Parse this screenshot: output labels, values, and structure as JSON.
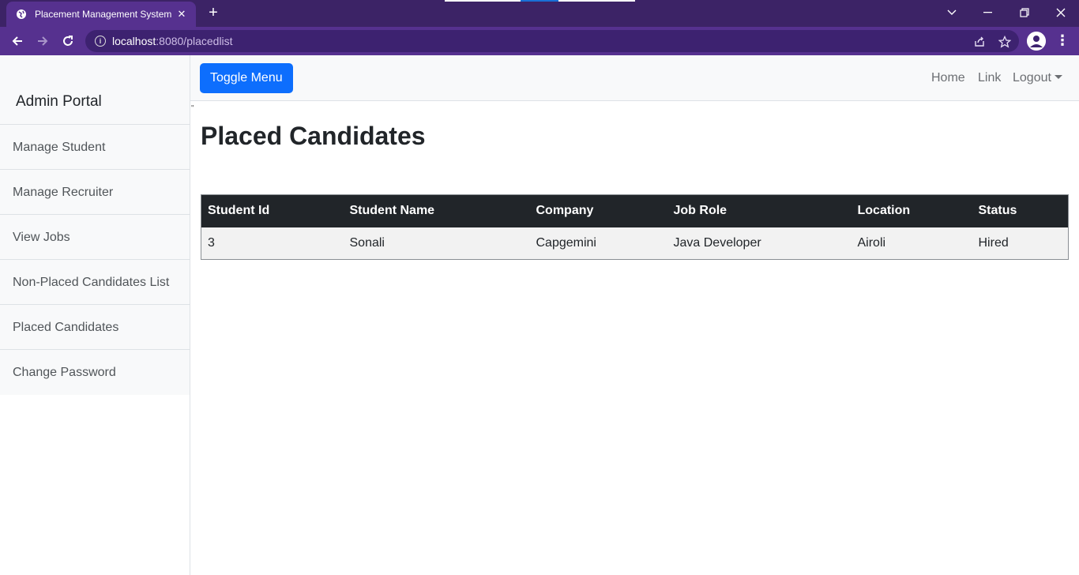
{
  "browser": {
    "tab_title": "Placement Management System",
    "close_glyph": "✕",
    "new_tab_glyph": "+",
    "url_host": "localhost",
    "url_rest": ":8080/placedlist",
    "theme_color": "#56318f"
  },
  "sidebar": {
    "heading": "Admin Portal",
    "items": [
      {
        "label": "Manage Student"
      },
      {
        "label": "Manage Recruiter"
      },
      {
        "label": "View Jobs"
      },
      {
        "label": "Non-Placed Candidates List"
      },
      {
        "label": "Placed Candidates"
      },
      {
        "label": "Change Password"
      }
    ]
  },
  "topnav": {
    "toggle_label": "Toggle Menu",
    "home_label": "Home",
    "link_label": "Link",
    "logout_label": "Logout"
  },
  "main": {
    "stray_mark": "\"",
    "title": "Placed Candidates",
    "table": {
      "headers": [
        "Student Id",
        "Student Name",
        "Company",
        "Job Role",
        "Location",
        "Status"
      ],
      "rows": [
        [
          "3",
          "Sonali",
          "Capgemini",
          "Java Developer",
          "Airoli",
          "Hired"
        ]
      ]
    }
  }
}
